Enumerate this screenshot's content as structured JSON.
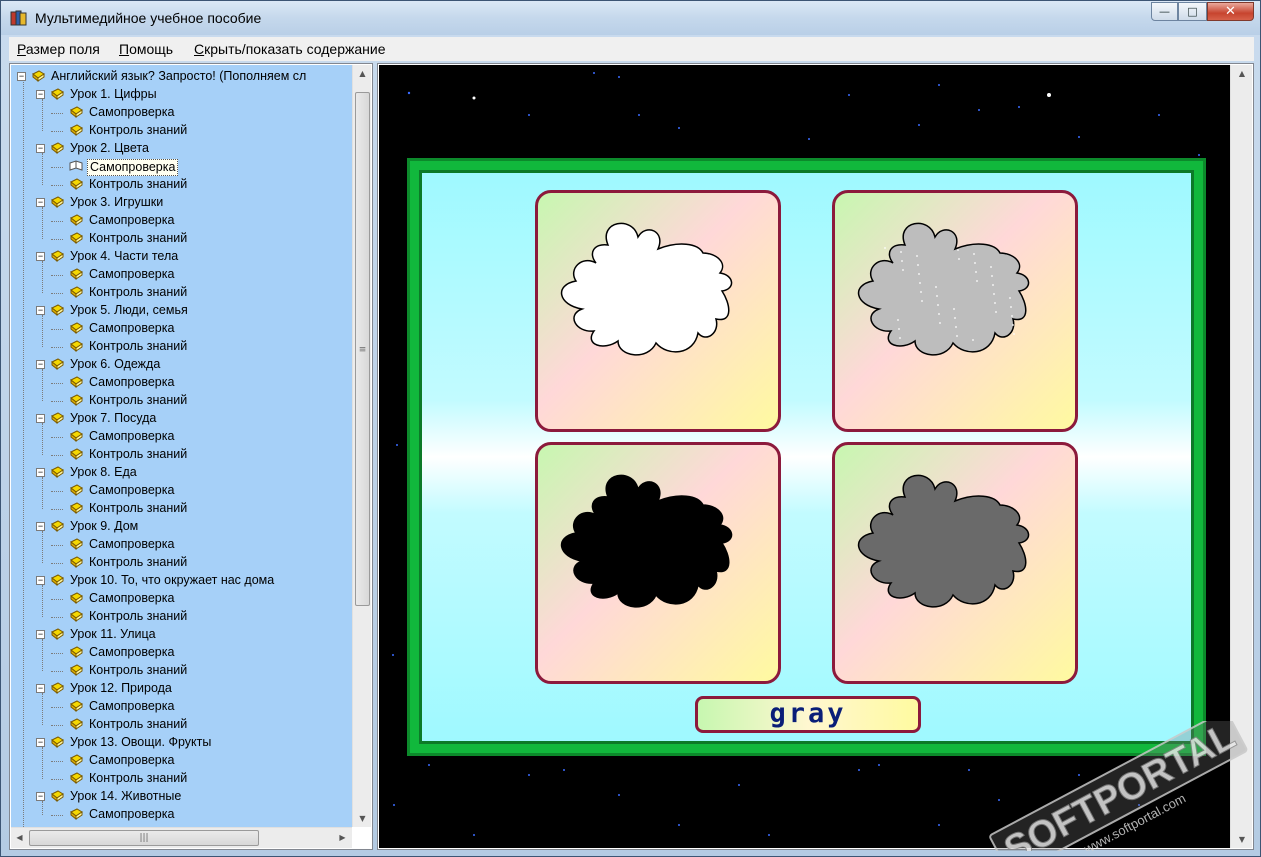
{
  "window": {
    "title": "Мультимедийное учебное пособие",
    "controls": {
      "minimize": "—",
      "maximize": "□",
      "close": "✕"
    }
  },
  "menu": [
    {
      "label": "Размер поля"
    },
    {
      "label": "Помощь"
    },
    {
      "label": "Скрыть/показать содержание"
    }
  ],
  "tree": {
    "root": "Английский язык? Запросто! (Пополняем сл",
    "lessons": [
      {
        "label": "Урок 1. Цифры",
        "children": [
          "Самопроверка",
          "Контроль знаний"
        ]
      },
      {
        "label": "Урок 2. Цвета",
        "children": [
          "Самопроверка",
          "Контроль знаний"
        ],
        "selected_child": 0
      },
      {
        "label": "Урок 3. Игрушки",
        "children": [
          "Самопроверка",
          "Контроль знаний"
        ]
      },
      {
        "label": "Урок 4. Части тела",
        "children": [
          "Самопроверка",
          "Контроль знаний"
        ]
      },
      {
        "label": "Урок 5. Люди, семья",
        "children": [
          "Самопроверка",
          "Контроль знаний"
        ]
      },
      {
        "label": "Урок 6. Одежда",
        "children": [
          "Самопроверка",
          "Контроль знаний"
        ]
      },
      {
        "label": "Урок 7. Посуда",
        "children": [
          "Самопроверка",
          "Контроль знаний"
        ]
      },
      {
        "label": "Урок 8. Еда",
        "children": [
          "Самопроверка",
          "Контроль знаний"
        ]
      },
      {
        "label": "Урок 9. Дом",
        "children": [
          "Самопроверка",
          "Контроль знаний"
        ]
      },
      {
        "label": "Урок 10. То, что окружает нас дома",
        "children": [
          "Самопроверка",
          "Контроль знаний"
        ]
      },
      {
        "label": "Урок 11. Улица",
        "children": [
          "Самопроверка",
          "Контроль знаний"
        ]
      },
      {
        "label": "Урок 12. Природа",
        "children": [
          "Самопроверка",
          "Контроль знаний"
        ]
      },
      {
        "label": "Урок 13. Овощи. Фрукты",
        "children": [
          "Самопроверка",
          "Контроль знаний"
        ]
      },
      {
        "label": "Урок 14. Животные",
        "children": [
          "Самопроверка"
        ]
      }
    ]
  },
  "exercise": {
    "word": "gray",
    "blots": [
      {
        "name": "white-blot",
        "fill": "#ffffff"
      },
      {
        "name": "light-gray-blot",
        "fill": "#bdbdbd"
      },
      {
        "name": "black-blot",
        "fill": "#000000"
      },
      {
        "name": "dark-gray-blot",
        "fill": "#6a6a6a"
      }
    ]
  },
  "watermark": {
    "brand": "SOFTPORTAL",
    "url": "www.softportal.com",
    "tm": "TM"
  },
  "colors": {
    "tree_bg": "#a6d0f8",
    "frame_green": "#11b83c",
    "card_border": "#8c1a3c",
    "word_text": "#0a1e78"
  }
}
